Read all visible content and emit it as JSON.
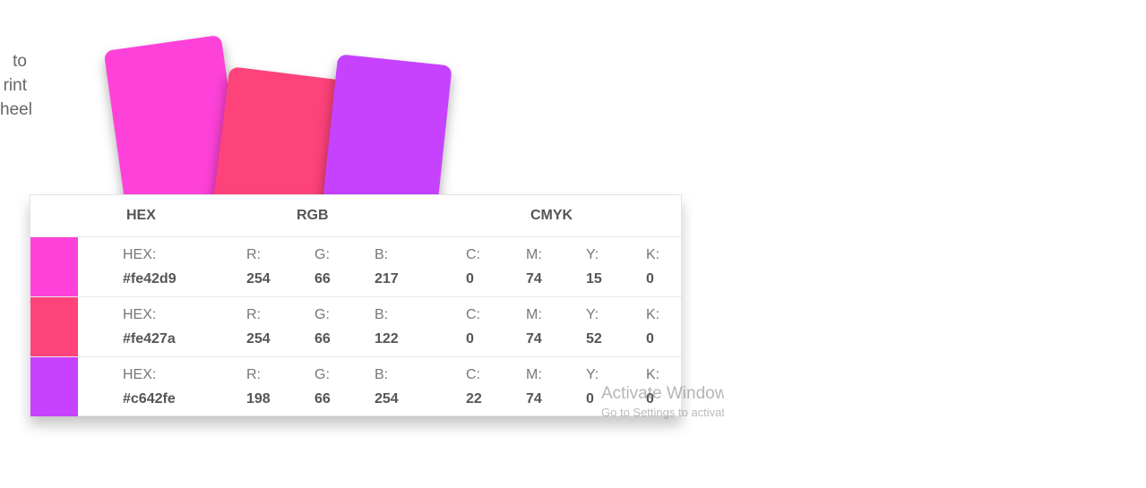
{
  "side_text": [
    "to",
    "rint",
    "heel"
  ],
  "cards": [
    {
      "color": "#fe42d9"
    },
    {
      "color": "#fe427a"
    },
    {
      "color": "#c642fe"
    }
  ],
  "table": {
    "headers": {
      "hex": "HEX",
      "rgb": "RGB",
      "cmyk": "CMYK"
    },
    "labels": {
      "hex": "HEX:",
      "r": "R:",
      "g": "G:",
      "b": "B:",
      "c": "C:",
      "m": "M:",
      "y": "Y:",
      "k": "K:"
    },
    "rows": [
      {
        "color": "#fe42d9",
        "hex": "#fe42d9",
        "r": "254",
        "g": "66",
        "b": "217",
        "c": "0",
        "m": "74",
        "y": "15",
        "k": "0"
      },
      {
        "color": "#fe427a",
        "hex": "#fe427a",
        "r": "254",
        "g": "66",
        "b": "122",
        "c": "0",
        "m": "74",
        "y": "52",
        "k": "0"
      },
      {
        "color": "#c642fe",
        "hex": "#c642fe",
        "r": "198",
        "g": "66",
        "b": "254",
        "c": "22",
        "m": "74",
        "y": "0",
        "k": "0"
      }
    ]
  },
  "watermark": {
    "title": "Activate Windows",
    "subtitle": "Go to Settings to activate Windows."
  }
}
